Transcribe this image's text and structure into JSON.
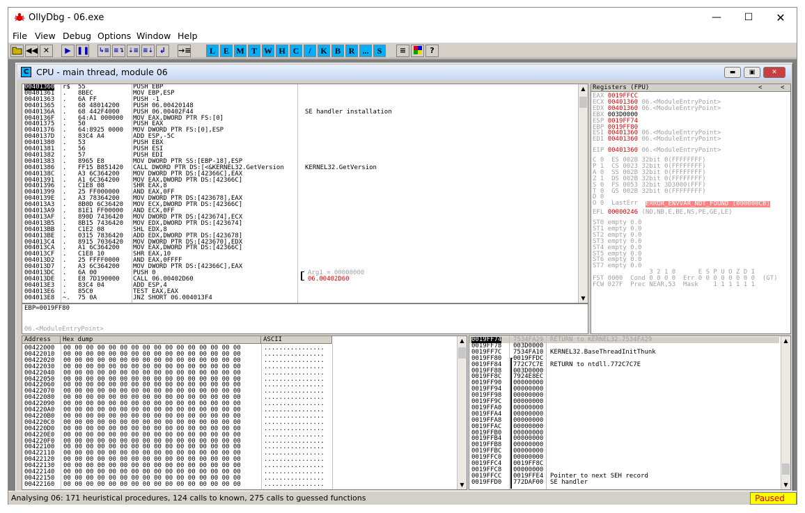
{
  "window": {
    "title": "OllyDbg - 06.exe"
  },
  "menu": [
    "File",
    "View",
    "Debug",
    "Options",
    "Window",
    "Help"
  ],
  "toolbar": {
    "letters": [
      "L",
      "E",
      "M",
      "T",
      "W",
      "H",
      "C",
      "/",
      "K",
      "B",
      "R",
      "...",
      "S"
    ]
  },
  "cpu_window": {
    "title": "CPU - main thread, module 06",
    "icon_label": "C"
  },
  "disasm": {
    "addresses": [
      "00401360",
      "00401361",
      "00401363",
      "00401365",
      "0040136A",
      "0040136F",
      "00401375",
      "00401376",
      "0040137D",
      "00401380",
      "00401381",
      "00401382",
      "00401383",
      "00401386",
      "0040138C",
      "00401391",
      "00401396",
      "00401399",
      "0040139E",
      "004013A3",
      "004013A9",
      "004013AF",
      "004013B5",
      "004013BB",
      "004013BE",
      "004013C4",
      "004013CA",
      "004013CF",
      "004013D2",
      "004013D7",
      "004013DC",
      "004013DE",
      "004013E3",
      "004013E6",
      "004013E8"
    ],
    "marks": [
      "r$",
      ". ",
      ". ",
      ". ",
      ". ",
      ". ",
      ". ",
      ". ",
      ". ",
      ". ",
      ". ",
      ". ",
      ". ",
      ". ",
      ". ",
      ". ",
      ". ",
      ". ",
      ". ",
      ". ",
      ". ",
      ". ",
      ". ",
      ". ",
      ". ",
      ". ",
      ". ",
      ". ",
      ". ",
      ". ",
      ". ",
      ". ",
      ". ",
      ". ",
      "~."
    ],
    "hex": [
      "55",
      "8BEC",
      "6A FF",
      "68 48014200",
      "68 442F4000",
      "64:A1 000000",
      "50",
      "64:8925 0000",
      "83C4 A4",
      "53",
      "56",
      "57",
      "8965 E8",
      "FF15 B851420",
      "A3 6C364200",
      "A1 6C364200",
      "C1E8 08",
      "25 FF000000",
      "A3 78364200",
      "8B0D 6C36420",
      "81E1 FF00000",
      "890D 7436420",
      "8B15 7436420",
      "C1E2 08",
      "0315 7836420",
      "8915 7036420",
      "A1 6C364200",
      "C1E8 10",
      "25 FFFF0000",
      "A3 6C364200",
      "6A 00",
      "E8 7D190000",
      "83C4 04",
      "85C0",
      "75 0A"
    ],
    "instructions": [
      "PUSH EBP",
      "MOV EBP,ESP",
      "PUSH -1",
      "PUSH 06.00420148",
      "PUSH 06.00402F44",
      "MOV EAX,DWORD PTR FS:[0]",
      "PUSH EAX",
      "MOV DWORD PTR FS:[0],ESP",
      "ADD ESP,-5C",
      "PUSH EBX",
      "PUSH ESI",
      "PUSH EDI",
      "MOV DWORD PTR SS:[EBP-18],ESP",
      "CALL DWORD PTR DS:[<&KERNEL32.GetVersion",
      "MOV DWORD PTR DS:[42366C],EAX",
      "MOV EAX,DWORD PTR DS:[42366C]",
      "SHR EAX,8",
      "AND EAX,0FF",
      "MOV DWORD PTR DS:[423678],EAX",
      "MOV ECX,DWORD PTR DS:[42366C]",
      "AND ECX,0FF",
      "MOV DWORD PTR DS:[423674],ECX",
      "MOV EDX,DWORD PTR DS:[423674]",
      "SHL EDX,8",
      "ADD EDX,DWORD PTR DS:[423678]",
      "MOV DWORD PTR DS:[423670],EDX",
      "MOV EAX,DWORD PTR DS:[42366C]",
      "SHR EAX,10",
      "AND EAX,0FFFF",
      "MOV DWORD PTR DS:[42366C],EAX",
      "PUSH 0",
      "CALL 06.00402D60",
      "ADD ESP,4",
      "TEST EAX,EAX",
      "JNZ SHORT 06.004013F4"
    ],
    "comments": [
      "",
      "",
      "",
      "",
      "SE handler installation",
      "",
      "",
      "",
      "",
      "",
      "",
      "",
      "",
      "KERNEL32.GetVersion",
      "",
      "",
      "",
      "",
      "",
      "",
      "",
      "",
      "",
      "",
      "",
      "",
      "",
      "",
      "",
      "",
      "Arg1 = 00000000",
      "06.00402D60",
      "",
      "",
      ""
    ]
  },
  "info": {
    "line1": "EBP=0019FF80",
    "line2": "06.<ModuleEntryPoint>"
  },
  "registers": {
    "header": "Registers (FPU)",
    "lines": [
      {
        "name": "EAX",
        "value": "0019FFCC",
        "comment": "",
        "red": true
      },
      {
        "name": "ECX",
        "value": "00401360",
        "comment": "06.<ModuleEntryPoint>",
        "red": true
      },
      {
        "name": "EDX",
        "value": "00401360",
        "comment": "06.<ModuleEntryPoint>",
        "red": true
      },
      {
        "name": "EBX",
        "value": "003D0000",
        "comment": "",
        "red": false
      },
      {
        "name": "ESP",
        "value": "0019FF74",
        "comment": "",
        "red": true
      },
      {
        "name": "EBP",
        "value": "0019FF80",
        "comment": "",
        "red": true
      },
      {
        "name": "ESI",
        "value": "00401360",
        "comment": "06.<ModuleEntryPoint>",
        "red": true
      },
      {
        "name": "EDI",
        "value": "00401360",
        "comment": "06.<ModuleEntryPoint>",
        "red": true
      }
    ],
    "eip": {
      "name": "EIP",
      "value": "00401360",
      "comment": "06.<ModuleEntryPoint>"
    },
    "flags": [
      "C 0  ES 002B 32bit 0(FFFFFFFF)",
      "P 1  CS 0023 32bit 0(FFFFFFFF)",
      "A 0  SS 002B 32bit 0(FFFFFFFF)",
      "Z 1  DS 002B 32bit 0(FFFFFFFF)",
      "S 0  FS 0053 32bit 3D3000(FFF)",
      "T 0  GS 002B 32bit 0(FFFFFFFF)",
      "D 0",
      "O 0  LastErr "
    ],
    "lasterr": "ERROR_ENVVAR_NOT_FOUND (000000CB)",
    "efl": {
      "label": "EFL",
      "value": "00000246",
      "comment": "(NO,NB,E,BE,NS,PE,GE,LE)"
    },
    "fpu": [
      "ST0 empty 0.0",
      "ST1 empty 0.0",
      "ST2 empty 0.0",
      "ST3 empty 0.0",
      "ST4 empty 0.0",
      "ST5 empty 0.0",
      "ST6 empty 0.0",
      "ST7 empty 0.0"
    ],
    "fst_header": "               3 2 1 0      E S P U O Z D I",
    "fst": "FST 0000  Cond 0 0 0 0  Err 0 0 0 0 0 0 0 0  (GT)",
    "fcw": "FCW 027F  Prec NEAR,53  Mask    1 1 1 1 1 1"
  },
  "dump": {
    "headers": [
      "Address",
      "Hex dump",
      "ASCII"
    ],
    "addresses": [
      "00422000",
      "00422010",
      "00422020",
      "00422030",
      "00422040",
      "00422050",
      "00422060",
      "00422070",
      "00422080",
      "00422090",
      "004220A0",
      "004220B0",
      "004220C0",
      "004220D0",
      "004220E0",
      "004220F0",
      "00422100",
      "00422110",
      "00422120",
      "00422130",
      "00422140",
      "00422150",
      "00422160"
    ],
    "hex_row": "00 00 00 00 00 00 00 00 00 00 00 00 00 00 00 00",
    "ascii_row": "................"
  },
  "stack": {
    "addresses": [
      "0019FF74",
      "0019FF78",
      "0019FF7C",
      "0019FF80",
      "0019FF84",
      "0019FF88",
      "0019FF8C",
      "0019FF90",
      "0019FF94",
      "0019FF98",
      "0019FF9C",
      "0019FFA0",
      "0019FFA4",
      "0019FFA8",
      "0019FFAC",
      "0019FFB0",
      "0019FFB4",
      "0019FFB8",
      "0019FFBC",
      "0019FFC0",
      "0019FFC4",
      "0019FFC8",
      "0019FFCC",
      "0019FFD0"
    ],
    "values": [
      "7534FA29",
      "003D0000",
      "7534FA10",
      "0019FFDC",
      "772C7C7E",
      "003D0000",
      "7924E8EC",
      "00000000",
      "00000000",
      "00000000",
      "00000000",
      "00000000",
      "00000000",
      "00000000",
      "00000000",
      "00000000",
      "00000000",
      "00000000",
      "00000000",
      "00000000",
      "0019FF8C",
      "00000000",
      "0019FFE4",
      "772DAF00"
    ],
    "comments": [
      "RETURN to KERNEL32.7534FA29",
      "",
      "KERNEL32.BaseThreadInitThunk",
      "",
      "RETURN to ntdll.772C7C7E",
      "",
      "",
      "",
      "",
      "",
      "",
      "",
      "",
      "",
      "",
      "",
      "",
      "",
      "",
      "",
      "",
      "",
      "Pointer to next SEH record",
      "SE handler"
    ]
  },
  "status": {
    "text": "Analysing 06: 171 heuristical procedures, 124 calls to known, 275 calls to guessed functions",
    "state": "Paused"
  }
}
